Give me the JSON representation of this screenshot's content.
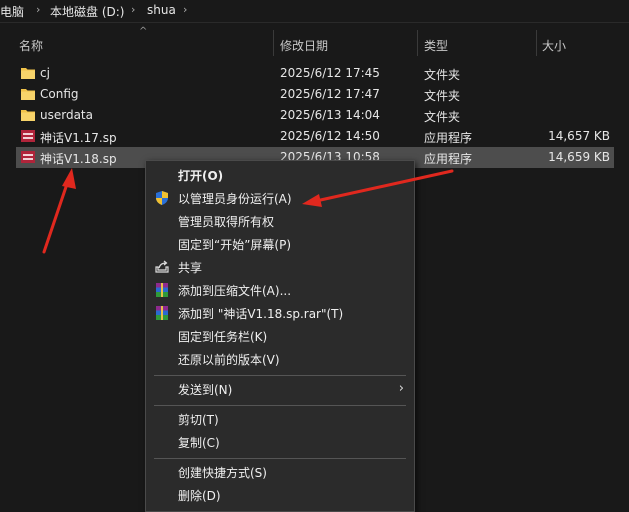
{
  "breadcrumb": [
    "电脑",
    "本地磁盘 (D:)",
    "shua"
  ],
  "columns": {
    "name": "名称",
    "date": "修改日期",
    "type": "类型",
    "size": "大小"
  },
  "files": [
    {
      "name": "cj",
      "date": "2025/6/12 17:45",
      "type": "文件夹",
      "size": "",
      "icon": "folder-icon"
    },
    {
      "name": "Config",
      "date": "2025/6/12 17:47",
      "type": "文件夹",
      "size": "",
      "icon": "folder-icon"
    },
    {
      "name": "userdata",
      "date": "2025/6/13 14:04",
      "type": "文件夹",
      "size": "",
      "icon": "folder-icon"
    },
    {
      "name": "神话V1.17.sp",
      "date": "2025/6/12 14:50",
      "type": "应用程序",
      "size": "14,657 KB",
      "icon": "app-icon"
    },
    {
      "name": "神话V1.18.sp",
      "date": "2025/6/13 10:58",
      "type": "应用程序",
      "size": "14,659 KB",
      "icon": "app-icon",
      "selected": true
    }
  ],
  "context_menu": {
    "open": "打开(O)",
    "run_as_admin": "以管理员身份运行(A)",
    "take_ownership": "管理员取得所有权",
    "pin_start": "固定到“开始”屏幕(P)",
    "share": "共享",
    "add_archive": "添加到压缩文件(A)...",
    "add_to_rar": "添加到 \"神话V1.18.sp.rar\"(T)",
    "pin_taskbar": "固定到任务栏(K)",
    "restore_versions": "还原以前的版本(V)",
    "send_to": "发送到(N)",
    "cut": "剪切(T)",
    "copy": "复制(C)",
    "create_shortcut": "创建快捷方式(S)",
    "delete": "删除(D)"
  },
  "colors": {
    "annotation_arrow": "#e0281e",
    "selection": "#4d4d4d",
    "folder": "#f0c24a"
  }
}
